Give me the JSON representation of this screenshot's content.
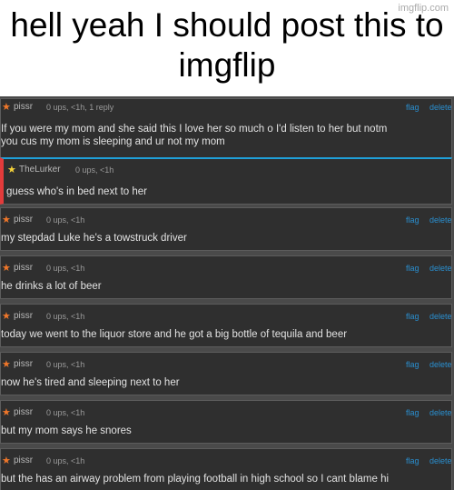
{
  "caption": "hell yeah I should post this to imgflip",
  "watermark": "imgflip.com",
  "comments": [
    {
      "user": "pissr",
      "stats": "0 ups, <1h, 1 reply",
      "flag": "flag",
      "delete": "delete",
      "lines": [
        "If you were my mom and she said this I love her so much o I'd listen to her but notm",
        "you cus my mom is sleeping and ur not my mom"
      ]
    },
    {
      "user": "TheLurker",
      "stats": "0 ups, <1h",
      "lines": [
        "guess who's in bed next to her"
      ]
    },
    {
      "user": "pissr",
      "stats": "0 ups, <1h",
      "flag": "flag",
      "delete": "delete",
      "lines": [
        "my stepdad Luke he's a towstruck driver"
      ]
    },
    {
      "user": "pissr",
      "stats": "0 ups, <1h",
      "flag": "flag",
      "delete": "delete",
      "lines": [
        "he drinks a lot of beer"
      ]
    },
    {
      "user": "pissr",
      "stats": "0 ups, <1h",
      "flag": "flag",
      "delete": "delete",
      "lines": [
        "today we went to the liquor store and he got a big bottle of tequila and beer"
      ]
    },
    {
      "user": "pissr",
      "stats": "0 ups, <1h",
      "flag": "flag",
      "delete": "delete",
      "lines": [
        "now he's tired and sleeping next to her"
      ]
    },
    {
      "user": "pissr",
      "stats": "0 ups, <1h",
      "flag": "flag",
      "delete": "delete",
      "lines": [
        "but my mom says he snores"
      ]
    },
    {
      "user": "pissr",
      "stats": "0 ups, <1h",
      "flag": "flag",
      "delete": "delete",
      "lines": [
        "but the has an airway problem from playing football in high school so I cant blame hi"
      ]
    }
  ],
  "colors": {
    "star_orange": "#f0772a",
    "star_yellow": "#f6d33a",
    "link_blue": "#2a8fd0",
    "reply_red": "#e33b3b"
  }
}
